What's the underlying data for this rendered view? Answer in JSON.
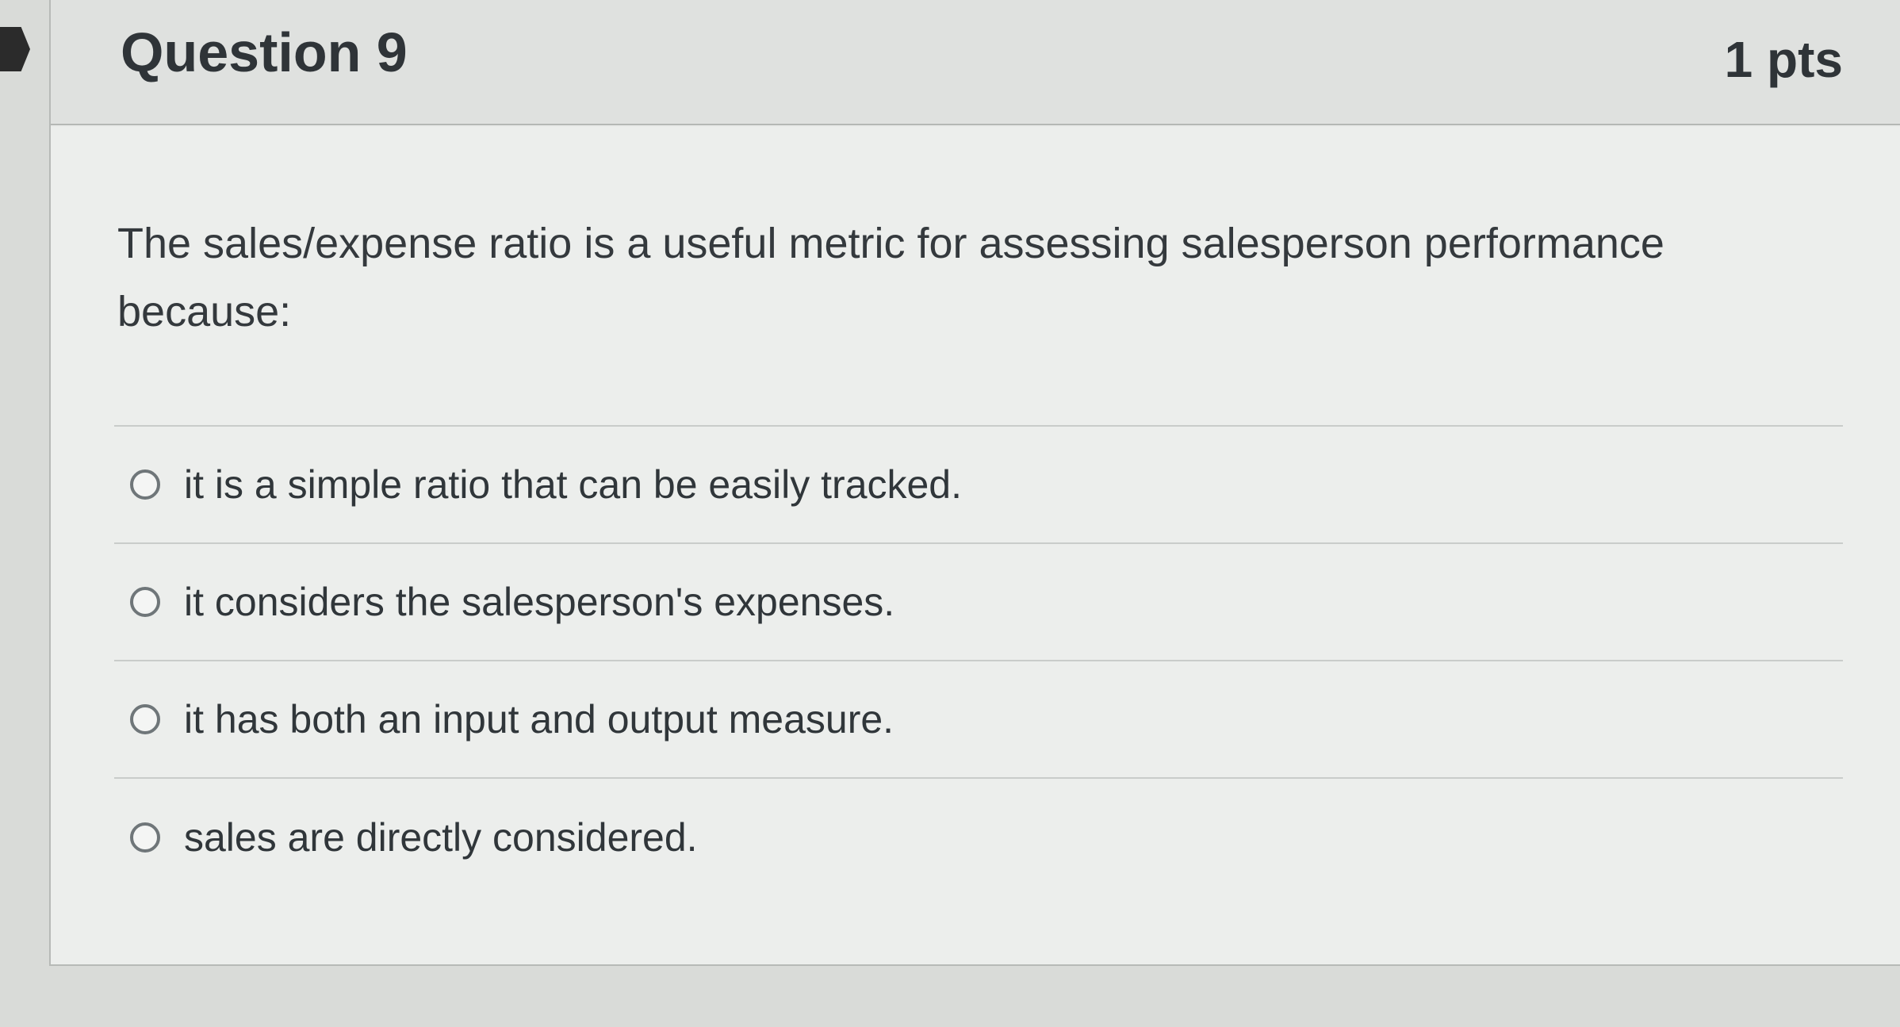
{
  "question": {
    "title": "Question 9",
    "points": "1 pts",
    "prompt": "The sales/expense ratio is a useful metric for assessing salesperson performance because:"
  },
  "answers": [
    {
      "label": "it is a simple ratio that can be easily tracked."
    },
    {
      "label": "it considers the salesperson's expenses."
    },
    {
      "label": "it has both an input and output measure."
    },
    {
      "label": "sales are directly considered."
    }
  ],
  "colors": {
    "header_background": "#dfe1df",
    "body_background": "#eceeec",
    "text": "#2f3438",
    "divider": "#c9ccca",
    "radio_border": "#6f7679"
  }
}
